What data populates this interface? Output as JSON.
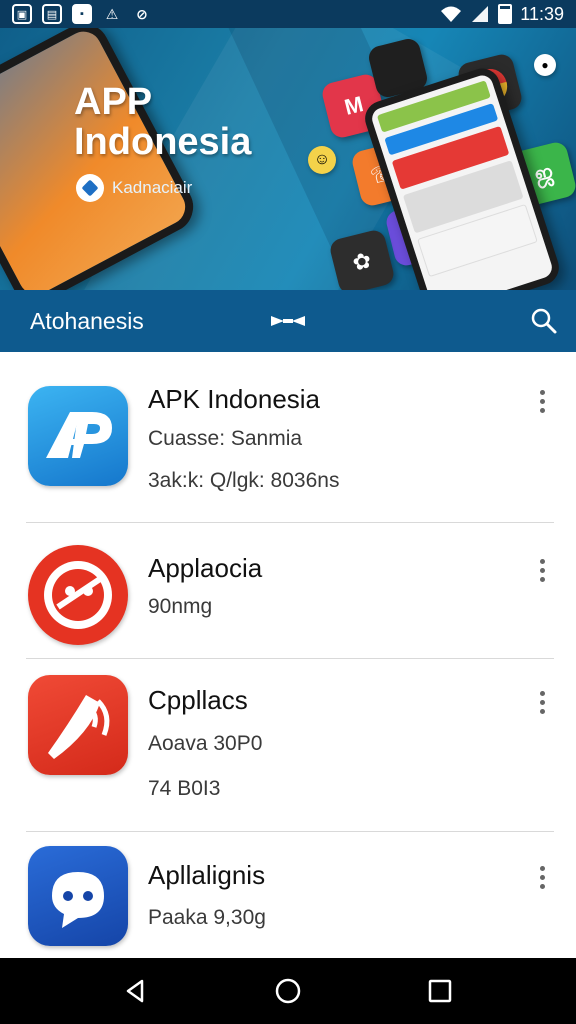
{
  "status_bar": {
    "time": "11:39",
    "icons": [
      "gallery-icon",
      "document-icon",
      "notification-icon",
      "signal-alert-icon",
      "block-icon",
      "wifi-icon",
      "cell-signal-icon",
      "battery-icon"
    ]
  },
  "banner": {
    "title_line1": "APP",
    "title_line2": "Indonesia",
    "subtitle": "Kadnaciair",
    "colors": {
      "background": "#1686b6",
      "phone_screen": "#f08a2a"
    }
  },
  "app_bar": {
    "title": "Atohanesis",
    "icons": [
      "bow-icon",
      "search-icon"
    ],
    "color": "#0e5a8e"
  },
  "apps": [
    {
      "title": "APK Indonesia",
      "line1": "Cuasse: Sanmia",
      "line2": "3ak:k: Q/lgk: 8036ns",
      "icon": "apk-logo-icon",
      "icon_color": "#1e9be0"
    },
    {
      "title": "Applaocia",
      "line1": "90nmg",
      "line2": "",
      "icon": "red-circle-logo-icon",
      "icon_color": "#e53322"
    },
    {
      "title": "Cppllacs",
      "line1": "Aoava 30P0",
      "line2": "74 B0I3",
      "icon": "phone-call-icon",
      "icon_color": "#e53322"
    },
    {
      "title": "Apllalignis",
      "line1": "Paaka 9,30g",
      "line2": "",
      "icon": "chat-bubble-icon",
      "icon_color": "#1e56c4"
    }
  ],
  "nav_bar": {
    "icons": [
      "back-icon",
      "home-icon",
      "recents-icon"
    ]
  }
}
